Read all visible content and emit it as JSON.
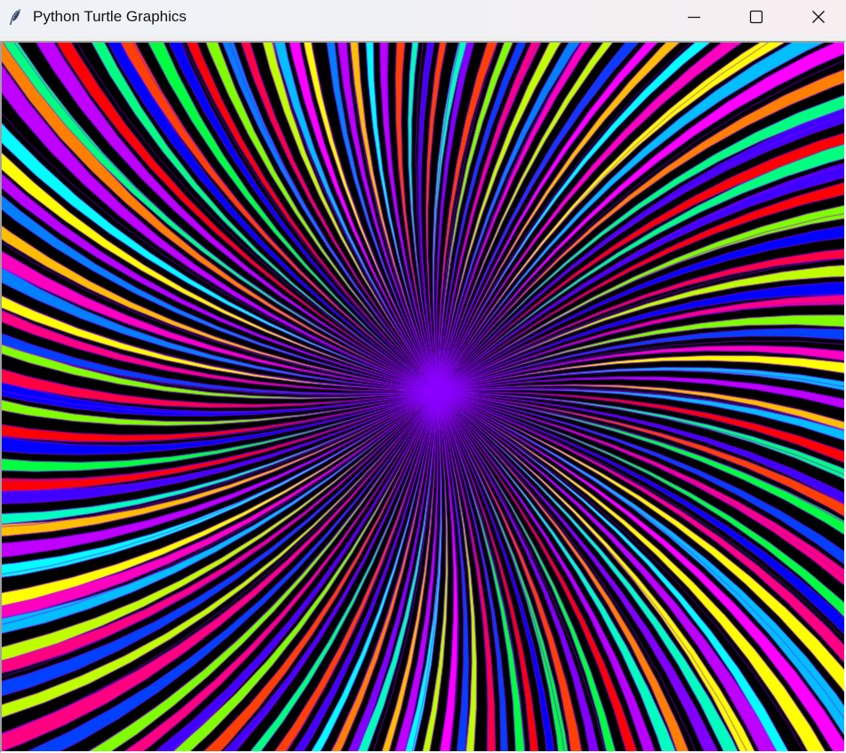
{
  "window": {
    "title": "Python Turtle Graphics",
    "app_icon": "feather-icon",
    "controls": {
      "minimize_icon": "minimize-icon",
      "maximize_icon": "maximize-icon",
      "close_icon": "close-icon"
    }
  },
  "canvas": {
    "background_color": "#000000",
    "outline_color": "#8a00ff",
    "palette": [
      "#ff0000",
      "#ff4000",
      "#ff8000",
      "#ffbf00",
      "#ffff00",
      "#bfff00",
      "#80ff00",
      "#00ff40",
      "#00ff80",
      "#00ffbf",
      "#00ffff",
      "#00bfff",
      "#0080ff",
      "#0040ff",
      "#0000ff",
      "#4000ff",
      "#8000ff",
      "#bf00ff",
      "#ff00ff",
      "#ff00bf",
      "#ff0080",
      "#ff0040"
    ]
  }
}
